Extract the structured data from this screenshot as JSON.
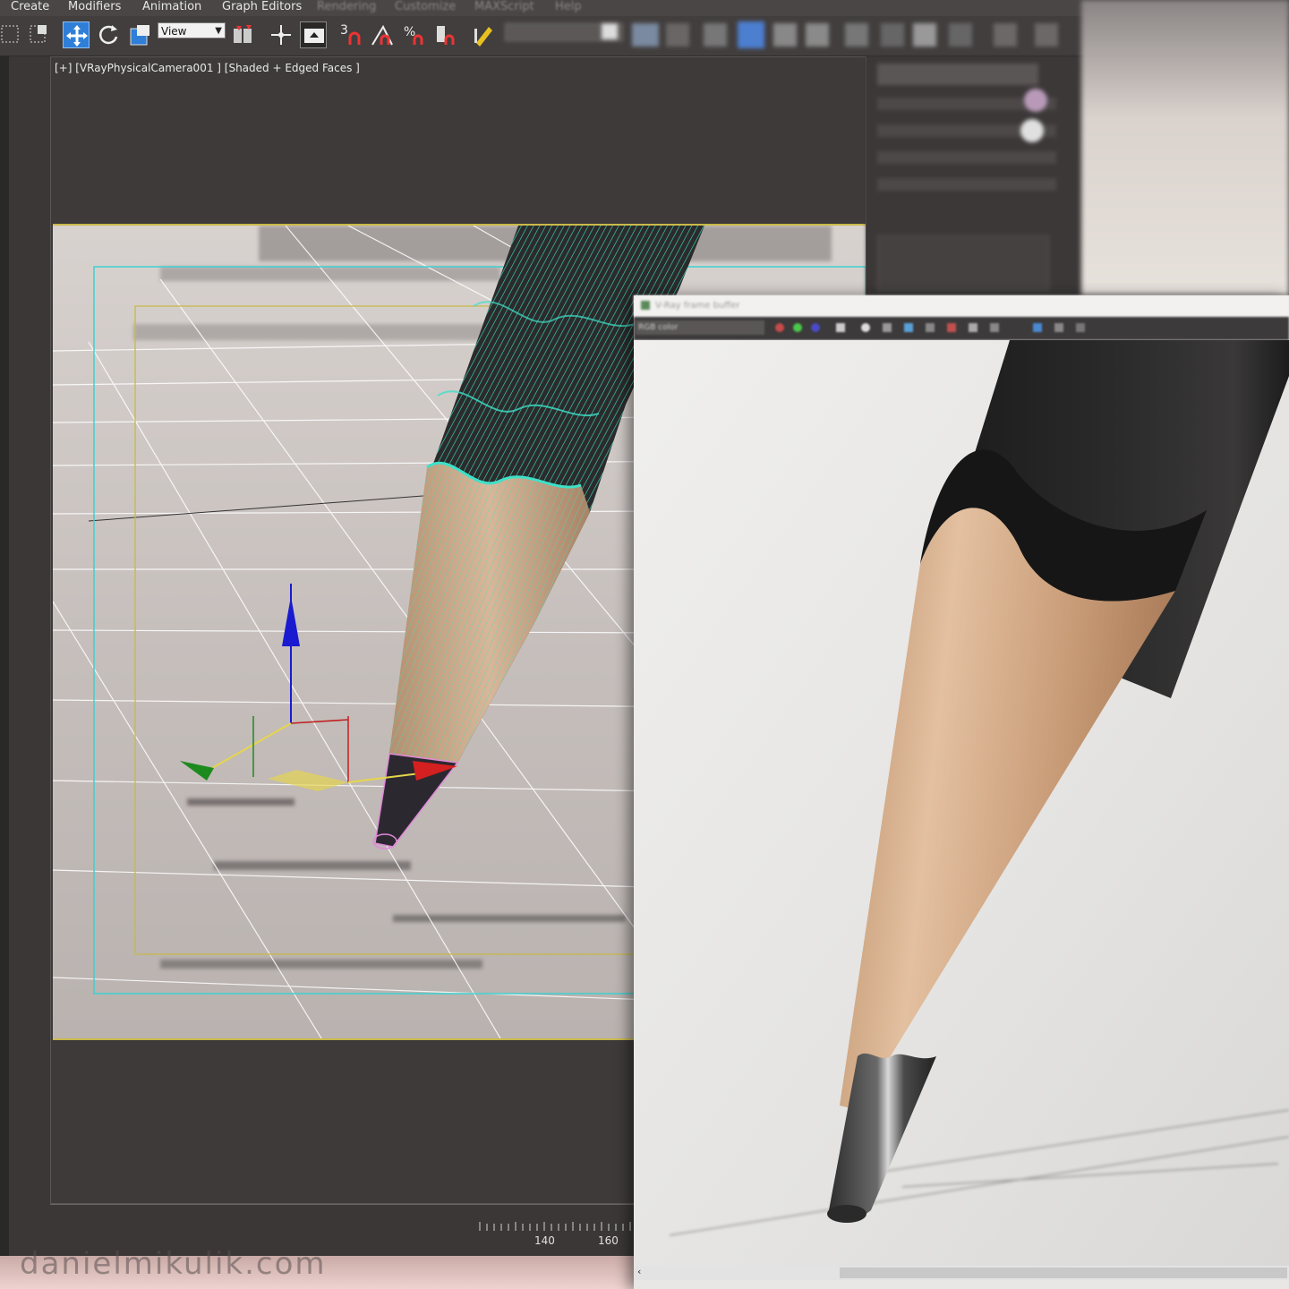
{
  "menu": {
    "items": [
      "Create",
      "Modifiers",
      "Animation",
      "Graph Editors",
      "Rendering",
      "Customize",
      "MAXScript",
      "Help"
    ]
  },
  "toolbar": {
    "reference_coord": "View",
    "snap_label": "3"
  },
  "viewport": {
    "label": "[+] [VRayPhysicalCamera001 ] [Shaded + Edged Faces ]"
  },
  "timeline": {
    "ticks": [
      "140",
      "160"
    ]
  },
  "vfb": {
    "title": "V-Ray frame buffer",
    "channel": "RGB color"
  },
  "watermark": "danielmikulik.com",
  "colors": {
    "wire": "#3fe0c8",
    "safe_frame": "#c9b94a",
    "gizmo_x": "#d42020",
    "gizmo_y": "#1d8a1d",
    "gizmo_z": "#1a1ad0"
  }
}
